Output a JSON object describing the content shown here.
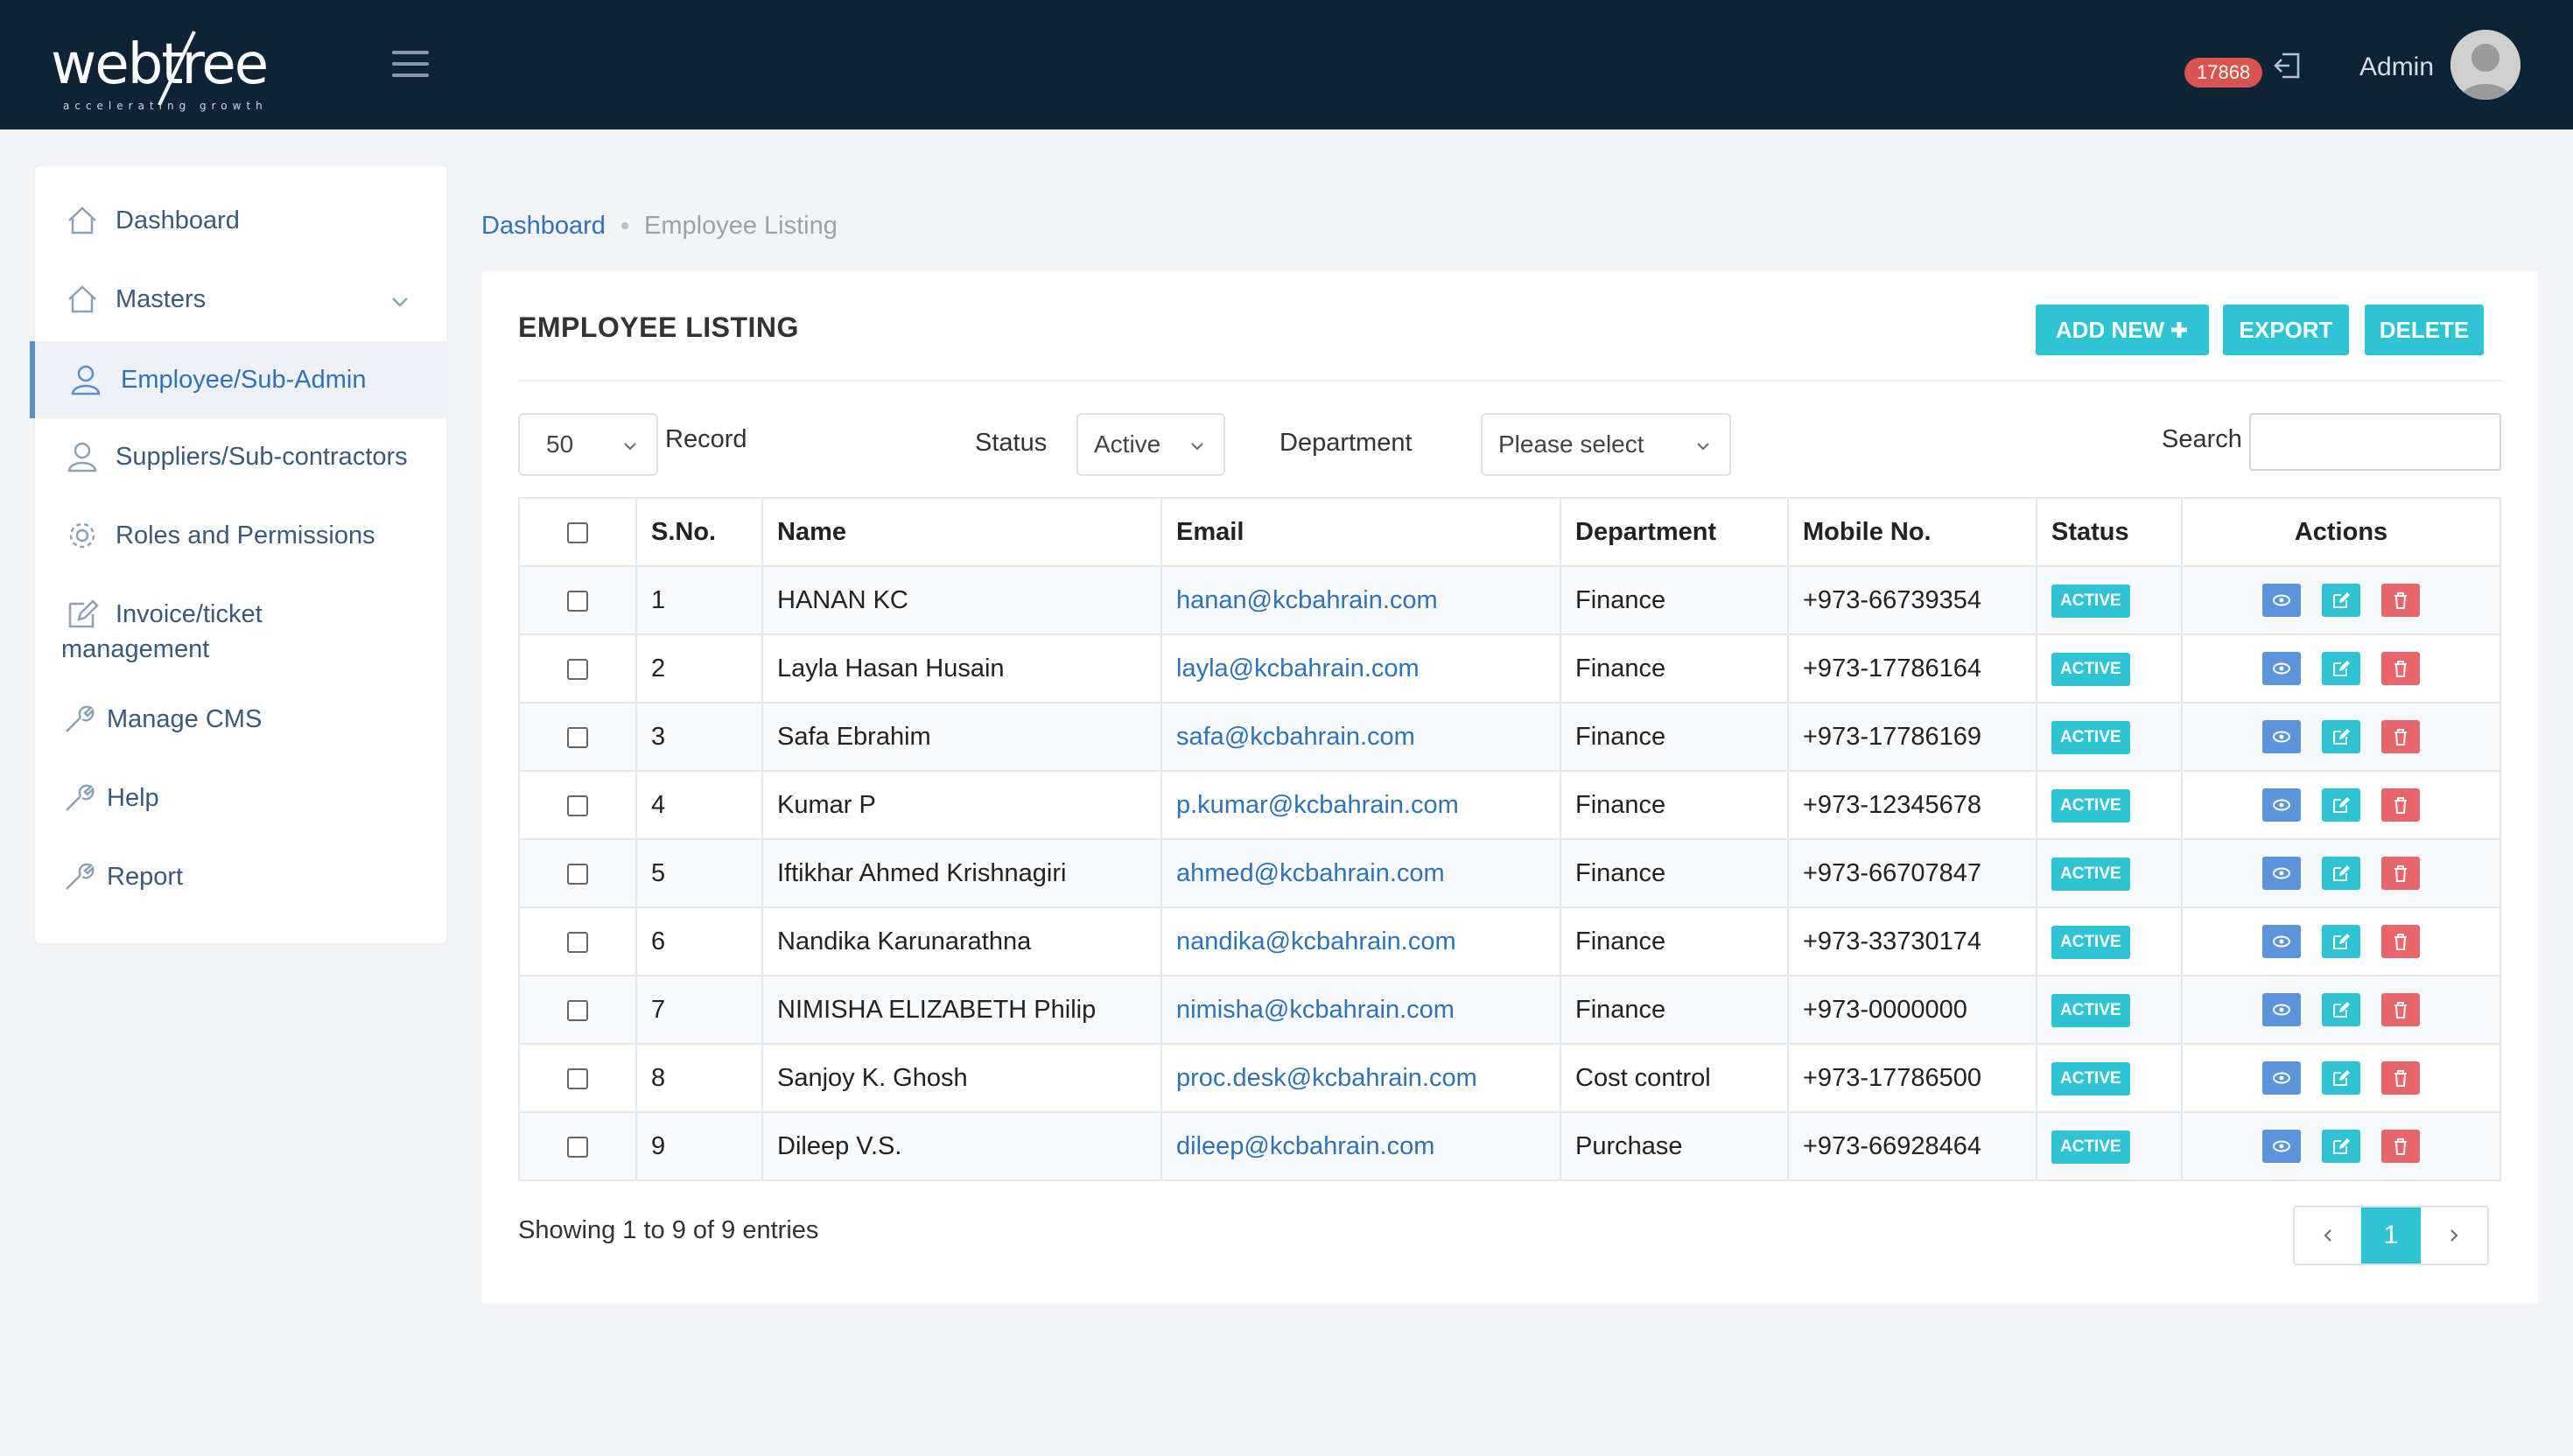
{
  "header": {
    "logo_text": "webtree",
    "logo_tagline": "accelerating growth",
    "notification_count": "17868",
    "user_name": "Admin"
  },
  "sidebar": {
    "items": [
      {
        "label": "Dashboard",
        "icon": "home-icon"
      },
      {
        "label": "Masters",
        "icon": "home-icon"
      },
      {
        "label": "Employee/Sub-Admin",
        "icon": "user-icon"
      },
      {
        "label": "Suppliers/Sub-contractors",
        "icon": "user-icon"
      },
      {
        "label": "Roles and Permissions",
        "icon": "gear-icon"
      },
      {
        "label": "Invoice/ticket",
        "label2": "management",
        "icon": "edit-icon"
      },
      {
        "label": "Manage CMS",
        "icon": "wrench-icon"
      },
      {
        "label": "Help",
        "icon": "wrench-icon"
      },
      {
        "label": "Report",
        "icon": "wrench-icon"
      }
    ]
  },
  "breadcrumb": {
    "home": "Dashboard",
    "current": "Employee Listing"
  },
  "card": {
    "title": "EMPLOYEE LISTING",
    "add_new_label": "ADD NEW",
    "export_label": "EXPORT",
    "delete_label": "DELETE"
  },
  "filters": {
    "records_value": "50",
    "records_label": "Record",
    "status_label": "Status",
    "status_value": "Active",
    "department_label": "Department",
    "department_value": "Please select",
    "search_label": "Search",
    "search_value": ""
  },
  "table": {
    "headers": [
      "S.No.",
      "Name",
      "Email",
      "Department",
      "Mobile No.",
      "Status",
      "Actions"
    ],
    "rows": [
      {
        "sno": "1",
        "name": "HANAN KC",
        "email": "hanan@kcbahrain.com",
        "department": "Finance",
        "mobile": "+973-66739354",
        "status": "ACTIVE"
      },
      {
        "sno": "2",
        "name": "Layla Hasan Husain",
        "email": "layla@kcbahrain.com",
        "department": "Finance",
        "mobile": "+973-17786164",
        "status": "ACTIVE"
      },
      {
        "sno": "3",
        "name": "Safa Ebrahim",
        "email": "safa@kcbahrain.com",
        "department": "Finance",
        "mobile": "+973-17786169",
        "status": "ACTIVE"
      },
      {
        "sno": "4",
        "name": "Kumar P",
        "email": "p.kumar@kcbahrain.com",
        "department": "Finance",
        "mobile": "+973-12345678",
        "status": "ACTIVE"
      },
      {
        "sno": "5",
        "name": "Iftikhar Ahmed Krishnagiri",
        "email": "ahmed@kcbahrain.com",
        "department": "Finance",
        "mobile": "+973-66707847",
        "status": "ACTIVE"
      },
      {
        "sno": "6",
        "name": "Nandika Karunarathna",
        "email": "nandika@kcbahrain.com",
        "department": "Finance",
        "mobile": "+973-33730174",
        "status": "ACTIVE"
      },
      {
        "sno": "7",
        "name": "NIMISHA ELIZABETH Philip",
        "email": "nimisha@kcbahrain.com",
        "department": "Finance",
        "mobile": "+973-0000000",
        "status": "ACTIVE"
      },
      {
        "sno": "8",
        "name": "Sanjoy K. Ghosh",
        "email": "proc.desk@kcbahrain.com",
        "department": "Cost control",
        "mobile": "+973-17786500",
        "status": "ACTIVE"
      },
      {
        "sno": "9",
        "name": "Dileep V.S.",
        "email": "dileep@kcbahrain.com",
        "department": "Purchase",
        "mobile": "+973-66928464",
        "status": "ACTIVE"
      }
    ]
  },
  "footer": {
    "showing_text": "Showing 1 to 9 of 9 entries",
    "current_page": "1"
  },
  "colors": {
    "topbar": "#0f2336",
    "accent": "#2ec4d4",
    "link": "#2d73b5",
    "view_button": "#5b94db",
    "delete_button": "#e8656a",
    "badge_red": "#d9534f"
  }
}
